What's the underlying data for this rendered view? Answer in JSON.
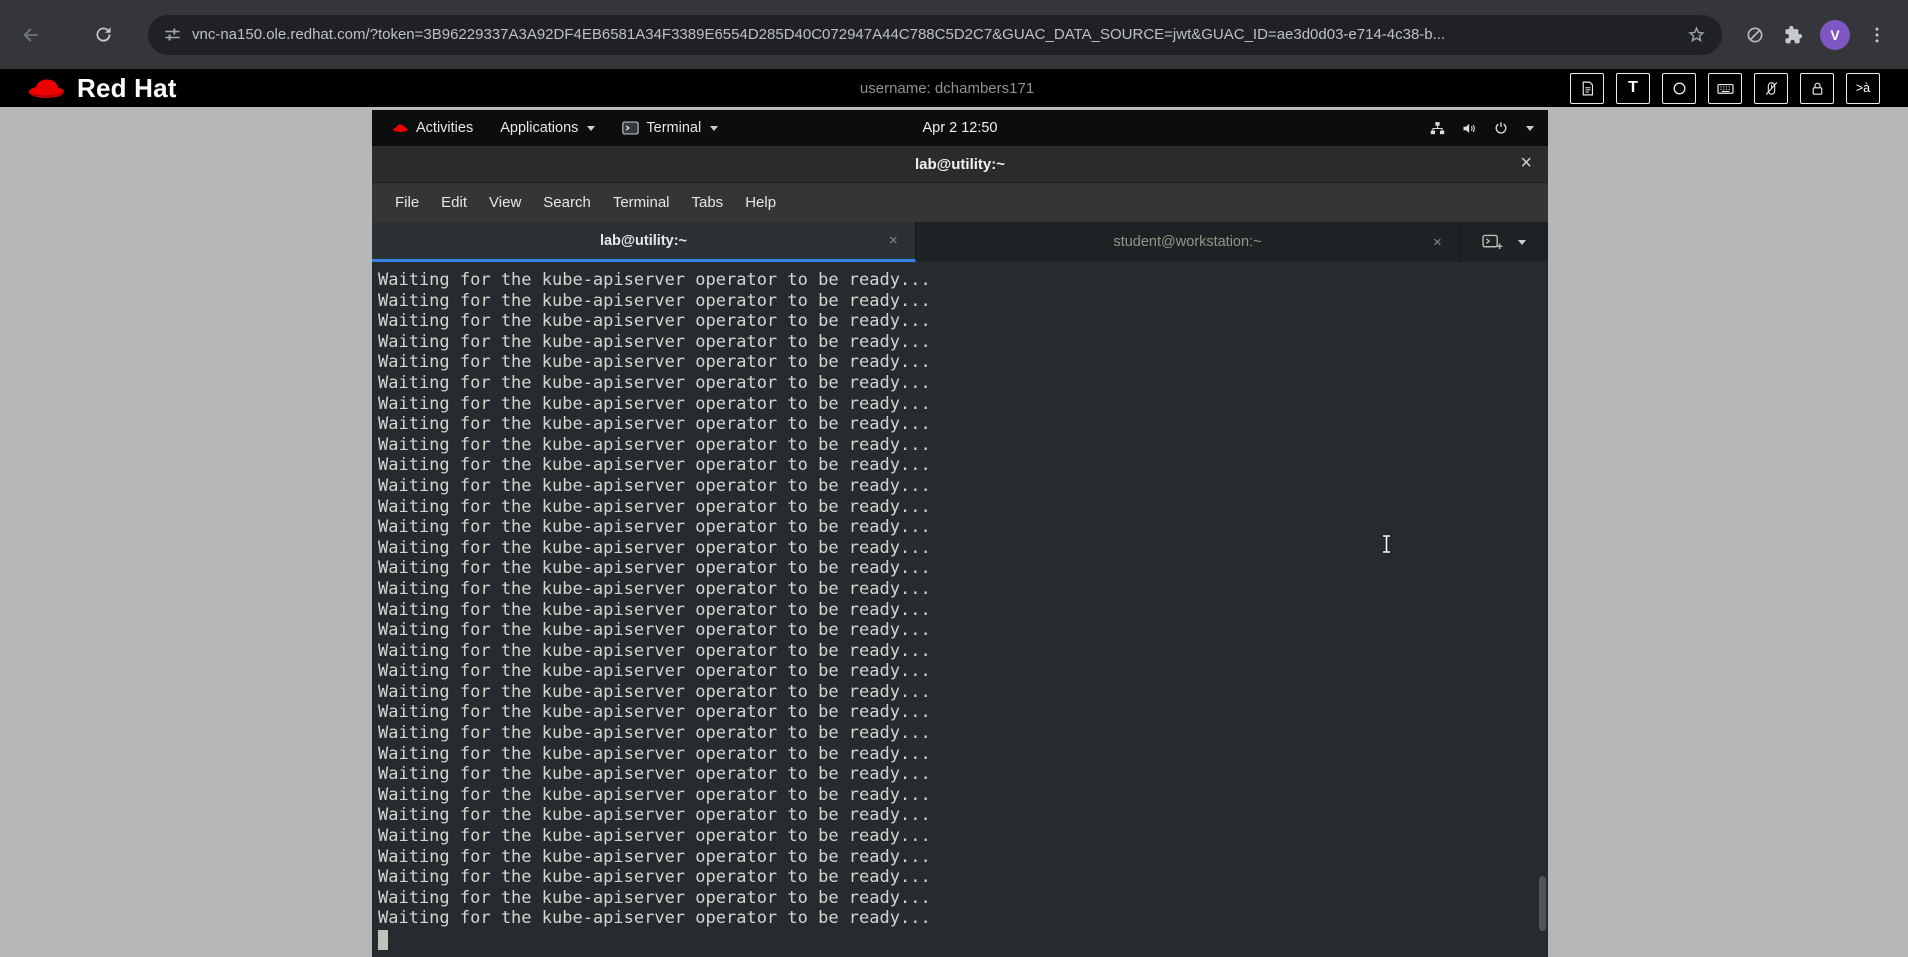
{
  "browser": {
    "url": "vnc-na150.ole.redhat.com/?token=3B96229337A3A92DF4EB6581A34F3389E6554D285D40C072947A44C788C5D2C7&GUAC_DATA_SOURCE=jwt&GUAC_ID=ae3d0d03-e714-4c38-b...",
    "profile_initial": "V"
  },
  "guac_header": {
    "brand": "Red Hat",
    "username": "username: dchambers171",
    "text_tool_label": "T",
    "ime_tool_label": ">à"
  },
  "desktop": {
    "top_bar": {
      "activities_label": "Activities",
      "applications_label": "Applications",
      "terminal_label": "Terminal",
      "clock": "Apr 2 12:50"
    },
    "window": {
      "title": "lab@utility:~",
      "close_label": "×",
      "tab_close_label": "×",
      "menus": [
        "File",
        "Edit",
        "View",
        "Search",
        "Terminal",
        "Tabs",
        "Help"
      ],
      "tabs": [
        {
          "label": "lab@utility:~"
        },
        {
          "label": "student@workstation:~"
        }
      ]
    },
    "terminal": {
      "line": "Waiting for the kube-apiserver operator to be ready...",
      "repeat": 32
    }
  },
  "colors": {
    "accent_blue": "#3584e4",
    "redhat_red": "#ee0000",
    "terminal_bg": "#262b30",
    "terminal_fg": "#d3d7cf"
  }
}
